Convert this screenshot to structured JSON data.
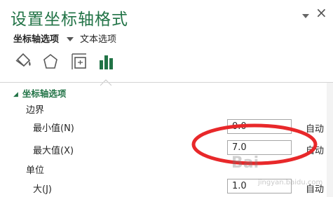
{
  "pane": {
    "title": "设置坐标轴格式",
    "tabs": [
      {
        "label": "坐标轴选项",
        "active": true
      },
      {
        "label": "文本选项",
        "active": false
      }
    ],
    "icons": [
      "fill-line-icon",
      "effects-pentagon-icon",
      "size-properties-icon",
      "axis-options-bar-chart-icon"
    ]
  },
  "section": {
    "title": "坐标轴选项",
    "bounds": {
      "label": "边界",
      "min": {
        "label": "最小值(N)",
        "value": "0.0",
        "auto": "自动"
      },
      "max": {
        "label": "最大值(X)",
        "value": "7.0",
        "auto": "自动"
      }
    },
    "units": {
      "label": "单位",
      "major": {
        "label": "大(J)",
        "value": "1.0",
        "auto": "自动"
      }
    }
  },
  "watermark": {
    "brand": "Bai",
    "sub": "jingyan.baidu.com"
  },
  "colors": {
    "accent": "#217346",
    "annotation": "#e8282a"
  }
}
